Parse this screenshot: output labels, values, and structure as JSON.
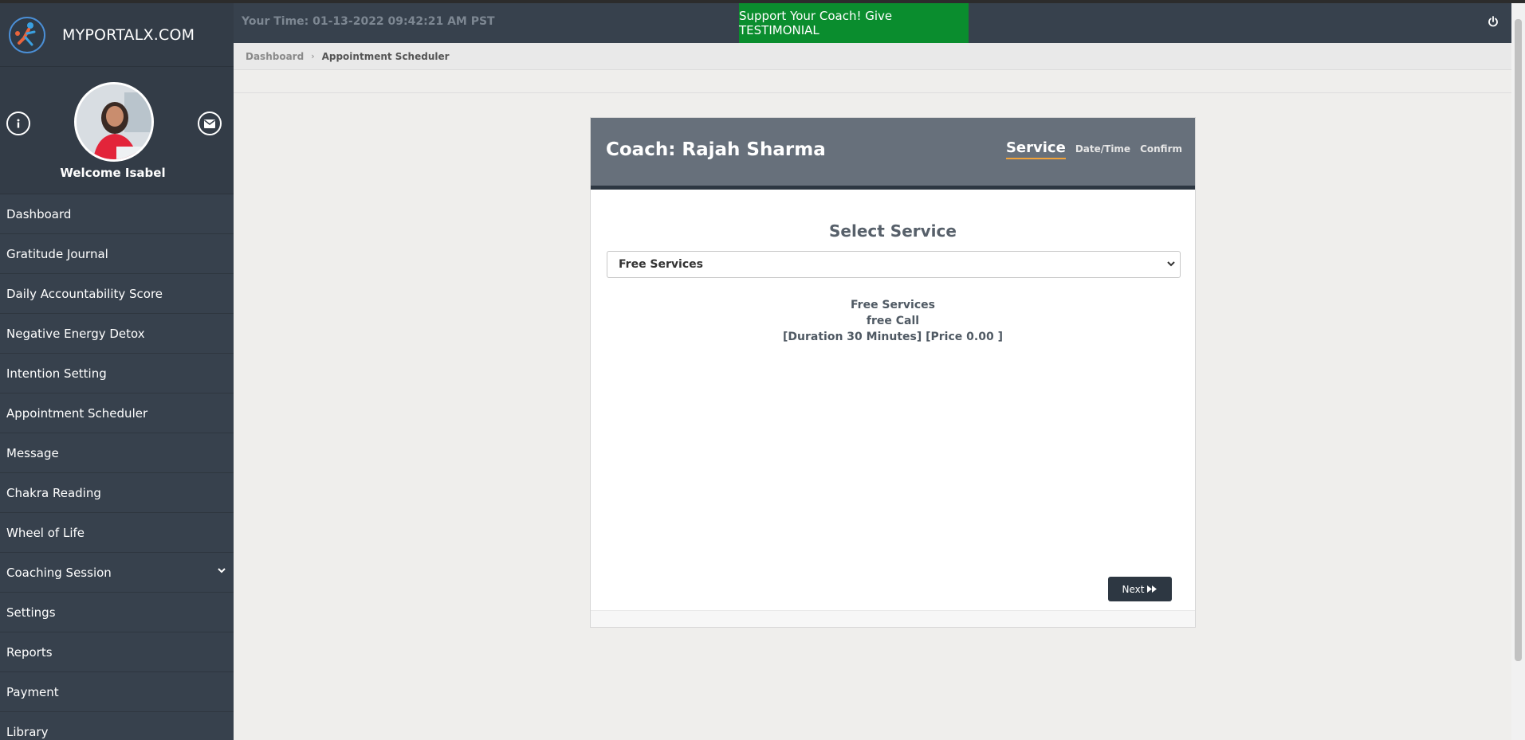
{
  "brand": {
    "name": "MYPORTALX.COM"
  },
  "profile": {
    "welcome": "Welcome Isabel"
  },
  "sidebar": {
    "items": [
      {
        "label": "Dashboard"
      },
      {
        "label": "Gratitude Journal"
      },
      {
        "label": "Daily Accountability Score"
      },
      {
        "label": "Negative Energy Detox"
      },
      {
        "label": "Intention Setting"
      },
      {
        "label": "Appointment Scheduler"
      },
      {
        "label": "Message"
      },
      {
        "label": "Chakra Reading"
      },
      {
        "label": "Wheel of Life"
      },
      {
        "label": "Coaching Session"
      },
      {
        "label": "Settings"
      },
      {
        "label": "Reports"
      },
      {
        "label": "Payment"
      },
      {
        "label": "Library"
      }
    ]
  },
  "topbar": {
    "time": "Your Time: 01-13-2022 09:42:21 AM PST",
    "testimonial": "Support Your Coach! Give TESTIMONIAL"
  },
  "breadcrumb": {
    "home": "Dashboard",
    "current": "Appointment Scheduler"
  },
  "card": {
    "coach": "Coach: Rajah Sharma",
    "steps": {
      "service": "Service",
      "datetime": "Date/Time",
      "confirm": "Confirm"
    },
    "select_title": "Select Service",
    "select_value": "Free Services",
    "info": {
      "category": "Free Services",
      "name": "free Call",
      "details": "[Duration 30 Minutes] [Price 0.00 ]"
    },
    "next_label": "Next"
  },
  "colors": {
    "sidebar": "#37414d",
    "testimonial": "#0a8d2e",
    "card_header": "#67707b",
    "active_step_underline": "#f2a33a"
  }
}
